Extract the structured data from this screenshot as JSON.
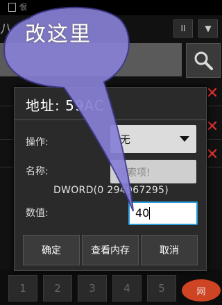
{
  "background": {
    "status_text": "恨",
    "side_letter": "八",
    "pause_glyph": "II",
    "collapse_glyph": "▼"
  },
  "dialog": {
    "title": "地址: 59AC",
    "labels": {
      "operation": "操作:",
      "name": "名称:",
      "value": "数值:"
    },
    "operation_value": "无",
    "name_placeholder": "搜索项!",
    "range_text": "DWORD(0   294967295)",
    "value_input": "40",
    "buttons": {
      "ok": "确定",
      "view_memory": "查看内存",
      "cancel": "取消"
    }
  },
  "annotation": {
    "text": "改这里",
    "fill": "#8880d6"
  },
  "numpad": [
    "1",
    "2",
    "3",
    "4",
    "5"
  ],
  "watermark": "网"
}
